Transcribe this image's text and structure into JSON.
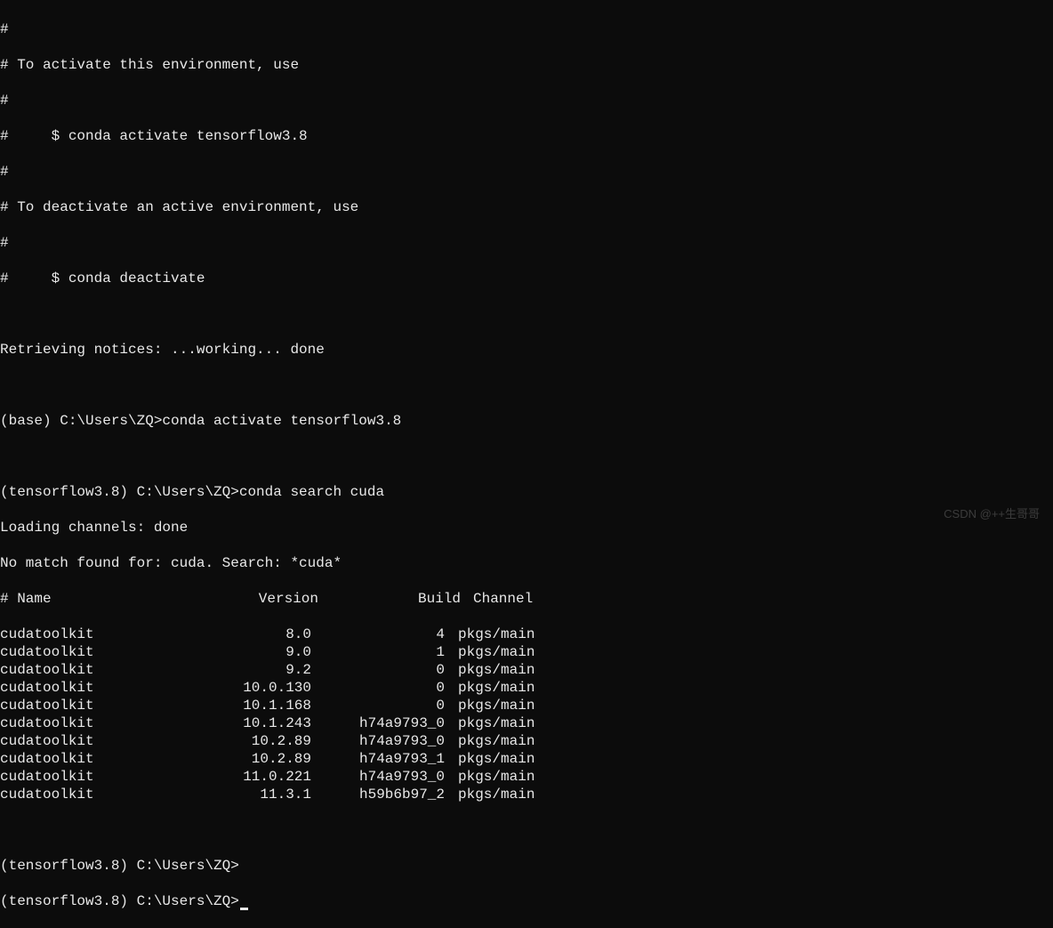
{
  "header": {
    "l1": "#",
    "l2": "# To activate this environment, use",
    "l3": "#",
    "l4": "#     $ conda activate tensorflow3.8",
    "l5": "#",
    "l6": "# To deactivate an active environment, use",
    "l7": "#",
    "l8": "#     $ conda deactivate"
  },
  "retrieving": "Retrieving notices: ...working... done",
  "prompt1": "(base) C:\\Users\\ZQ>conda activate tensorflow3.8",
  "prompt2": "(tensorflow3.8) C:\\Users\\ZQ>conda search cuda",
  "loading": "Loading channels: done",
  "nomatch": "No match found for: cuda. Search: *cuda*",
  "table": {
    "header": {
      "name": "# Name",
      "version": "Version",
      "build": "Build",
      "channel": "Channel"
    },
    "rows": [
      {
        "name": "cudatoolkit",
        "version": "8.0",
        "build": "4",
        "channel": "pkgs/main"
      },
      {
        "name": "cudatoolkit",
        "version": "9.0",
        "build": "1",
        "channel": "pkgs/main"
      },
      {
        "name": "cudatoolkit",
        "version": "9.2",
        "build": "0",
        "channel": "pkgs/main"
      },
      {
        "name": "cudatoolkit",
        "version": "10.0.130",
        "build": "0",
        "channel": "pkgs/main"
      },
      {
        "name": "cudatoolkit",
        "version": "10.1.168",
        "build": "0",
        "channel": "pkgs/main"
      },
      {
        "name": "cudatoolkit",
        "version": "10.1.243",
        "build": "h74a9793_0",
        "channel": "pkgs/main"
      },
      {
        "name": "cudatoolkit",
        "version": "10.2.89",
        "build": "h74a9793_0",
        "channel": "pkgs/main"
      },
      {
        "name": "cudatoolkit",
        "version": "10.2.89",
        "build": "h74a9793_1",
        "channel": "pkgs/main"
      },
      {
        "name": "cudatoolkit",
        "version": "11.0.221",
        "build": "h74a9793_0",
        "channel": "pkgs/main"
      },
      {
        "name": "cudatoolkit",
        "version": "11.3.1",
        "build": "h59b6b97_2",
        "channel": "pkgs/main"
      }
    ]
  },
  "prompt3": "(tensorflow3.8) C:\\Users\\ZQ>",
  "prompt4": "(tensorflow3.8) C:\\Users\\ZQ>",
  "watermark": "CSDN @++生哥哥"
}
